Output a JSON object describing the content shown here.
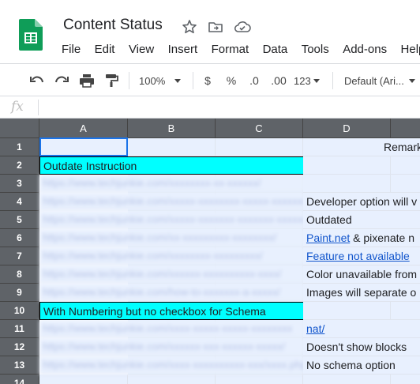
{
  "app": {
    "title": "Content Status"
  },
  "menu": [
    "File",
    "Edit",
    "View",
    "Insert",
    "Format",
    "Data",
    "Tools",
    "Add-ons",
    "Help"
  ],
  "toolbar": {
    "zoom": "100%",
    "currency": "$",
    "percent": "%",
    "decrease_decimals": ".0",
    "increase_decimals": ".00",
    "more_formats": "123",
    "font": "Default (Ari..."
  },
  "formula_bar": {
    "fx": "fx",
    "value": ""
  },
  "columns": [
    "A",
    "B",
    "C",
    "D"
  ],
  "rows": [
    {
      "num": "1",
      "a": "",
      "a_style": "",
      "d": "Remarks",
      "d_style": "center"
    },
    {
      "num": "2",
      "a": "Outdate Instruction",
      "a_style": "cyan",
      "d": "",
      "d_style": ""
    },
    {
      "num": "3",
      "a": "https://www.techjunkie.com/xxxxxxxx-xx-xxxxxx/",
      "a_style": "blurred",
      "d": "",
      "d_style": ""
    },
    {
      "num": "4",
      "a": "https://www.techjunkie.com/xxxxx-xxxxxxxx-xxxxx-xxxxxxxxx/",
      "a_style": "blurred",
      "d": "Developer option will v",
      "d_style": ""
    },
    {
      "num": "5",
      "a": "https://www.techjunkie.com/xxxxx-xxxxxxx-xxxxxxx-xxxxxx/",
      "a_style": "blurred",
      "d": "Outdated",
      "d_style": ""
    },
    {
      "num": "6",
      "a": "https://www.techjunkie.com/xx-xxxxxxxxx-xxxxxxxx/",
      "a_style": "blurred",
      "d_link": "Paint.net",
      "d": " & pixenate n",
      "d_style": "mixed"
    },
    {
      "num": "7",
      "a": "https://www.techjunkie.com/xxxxxxxx-xxxxxxxxx/",
      "a_style": "blurred",
      "d": "Feature not available",
      "d_style": "link"
    },
    {
      "num": "8",
      "a": "https://www.techjunkie.com/xxxxxx-xxxxxxxxxx-xxxx/",
      "a_style": "blurred",
      "d": "Color unavailable from",
      "d_style": ""
    },
    {
      "num": "9",
      "a": "https://www.techjunkie.com/how-to-xxxxxxx-a-xxxxx/",
      "a_style": "blurred",
      "d": "Images will separate o",
      "d_style": ""
    },
    {
      "num": "10",
      "a": "With Numbering but no checkbox for Schema",
      "a_style": "cyan",
      "d": "",
      "d_style": ""
    },
    {
      "num": "11",
      "a": "https://www.techjunkie.com/xxxx-xxxxx-xxxxx-xxxxxxxx",
      "a_style": "blurred",
      "d": "nat/",
      "d_style": "link"
    },
    {
      "num": "12",
      "a": "https://www.techjunkie.com/xxxxxx-xxx-xxxxxx-xxxxx/",
      "a_style": "blurred",
      "d": "Doesn't show blocks",
      "d_style": ""
    },
    {
      "num": "13",
      "a": "https://www.techjunkie.com/xxxx-xxxxxxxxxx-xxx/xxxx.php?",
      "a_style": "blurred",
      "d": "No schema option",
      "d_style": ""
    },
    {
      "num": "14",
      "a": "",
      "a_style": "",
      "d": "",
      "d_style": ""
    }
  ]
}
